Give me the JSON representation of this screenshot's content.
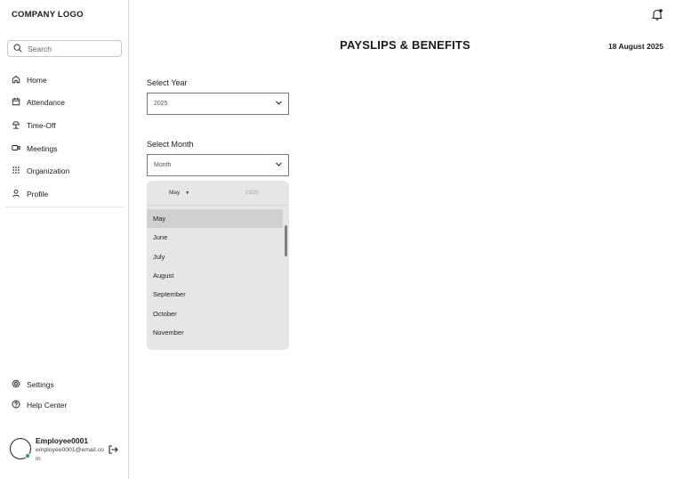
{
  "sidebar": {
    "logo": "COMPANY LOGO",
    "search_placeholder": "Search",
    "items": [
      {
        "label": "Home",
        "icon": "home-icon"
      },
      {
        "label": "Attendance",
        "icon": "calendar-icon"
      },
      {
        "label": "Time-Off",
        "icon": "beach-icon"
      },
      {
        "label": "Meetings",
        "icon": "video-icon"
      },
      {
        "label": "Organization",
        "icon": "grid-icon"
      },
      {
        "label": "Profile",
        "icon": "user-icon"
      }
    ],
    "bottom_items": [
      {
        "label": "Settings",
        "icon": "gear-icon"
      },
      {
        "label": "Help Center",
        "icon": "help-icon"
      }
    ],
    "user": {
      "name": "Employee0001",
      "email": "employee0001@email.com",
      "status_color": "#2e9e4a"
    }
  },
  "header": {
    "title": "PAYSLIPS & BENEFITS",
    "date": "18 August 2025"
  },
  "form": {
    "year_label": "Select Year",
    "year_value": "2025",
    "month_label": "Select Month",
    "month_placeholder": "Month"
  },
  "month_dropdown": {
    "header_month": "May",
    "header_year": "2025",
    "options": [
      "May",
      "June",
      "July",
      "August",
      "September",
      "October",
      "November"
    ],
    "selected": "May"
  }
}
